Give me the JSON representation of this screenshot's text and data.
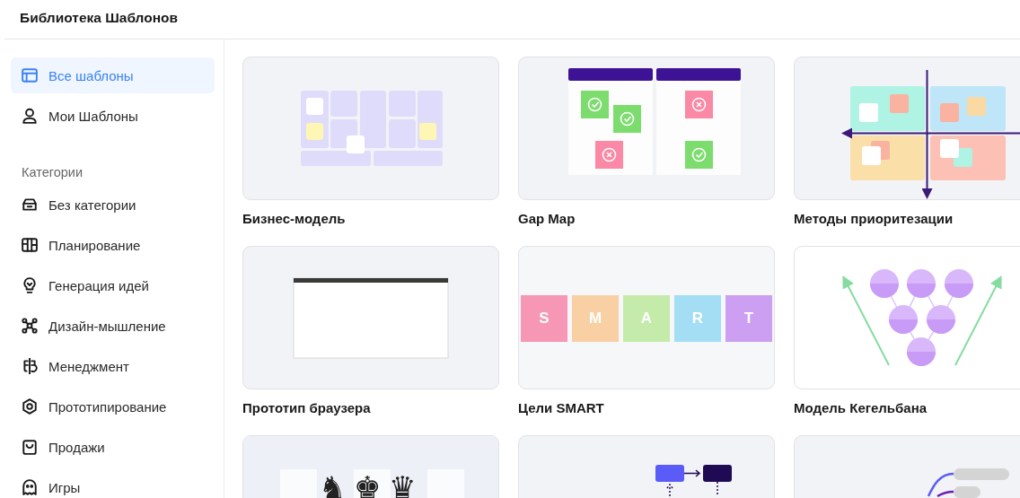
{
  "header": {
    "title": "Библиотека Шаблонов"
  },
  "sidebar": {
    "items": [
      {
        "label": "Все шаблоны",
        "kind": "layout",
        "selected": true
      },
      {
        "label": "Мои Шаблоны",
        "kind": "user",
        "selected": false
      }
    ],
    "section_title": "Категории",
    "categories": [
      {
        "label": "Без категории",
        "kind": "inbox",
        "selected": false
      },
      {
        "label": "Планирование",
        "kind": "board",
        "selected": false
      },
      {
        "label": "Генерация идей",
        "kind": "bulb",
        "selected": false
      },
      {
        "label": "Дизайн-мышление",
        "kind": "nodes",
        "selected": false
      },
      {
        "label": "Менеджмент",
        "kind": "split",
        "selected": false
      },
      {
        "label": "Прототипирование",
        "kind": "hex",
        "selected": false
      },
      {
        "label": "Продажи",
        "kind": "bag",
        "selected": false
      },
      {
        "label": "Игры",
        "kind": "ghost",
        "selected": false
      }
    ]
  },
  "templates": [
    {
      "title": "Бизнес-модель",
      "kind": "business"
    },
    {
      "title": "Gap Map",
      "kind": "gap"
    },
    {
      "title": "Методы приоритезации",
      "kind": "quadrant"
    },
    {
      "title": "Прототип браузера",
      "kind": "browser"
    },
    {
      "title": "Цели SMART",
      "kind": "smart",
      "letters": [
        "S",
        "M",
        "A",
        "R",
        "T"
      ]
    },
    {
      "title": "Модель Кегельбана",
      "kind": "pins"
    },
    {
      "kind": "chess",
      "pieces": [
        "♞",
        "♚",
        "♛"
      ]
    },
    {
      "kind": "flow"
    },
    {
      "kind": "mindmap"
    }
  ]
}
